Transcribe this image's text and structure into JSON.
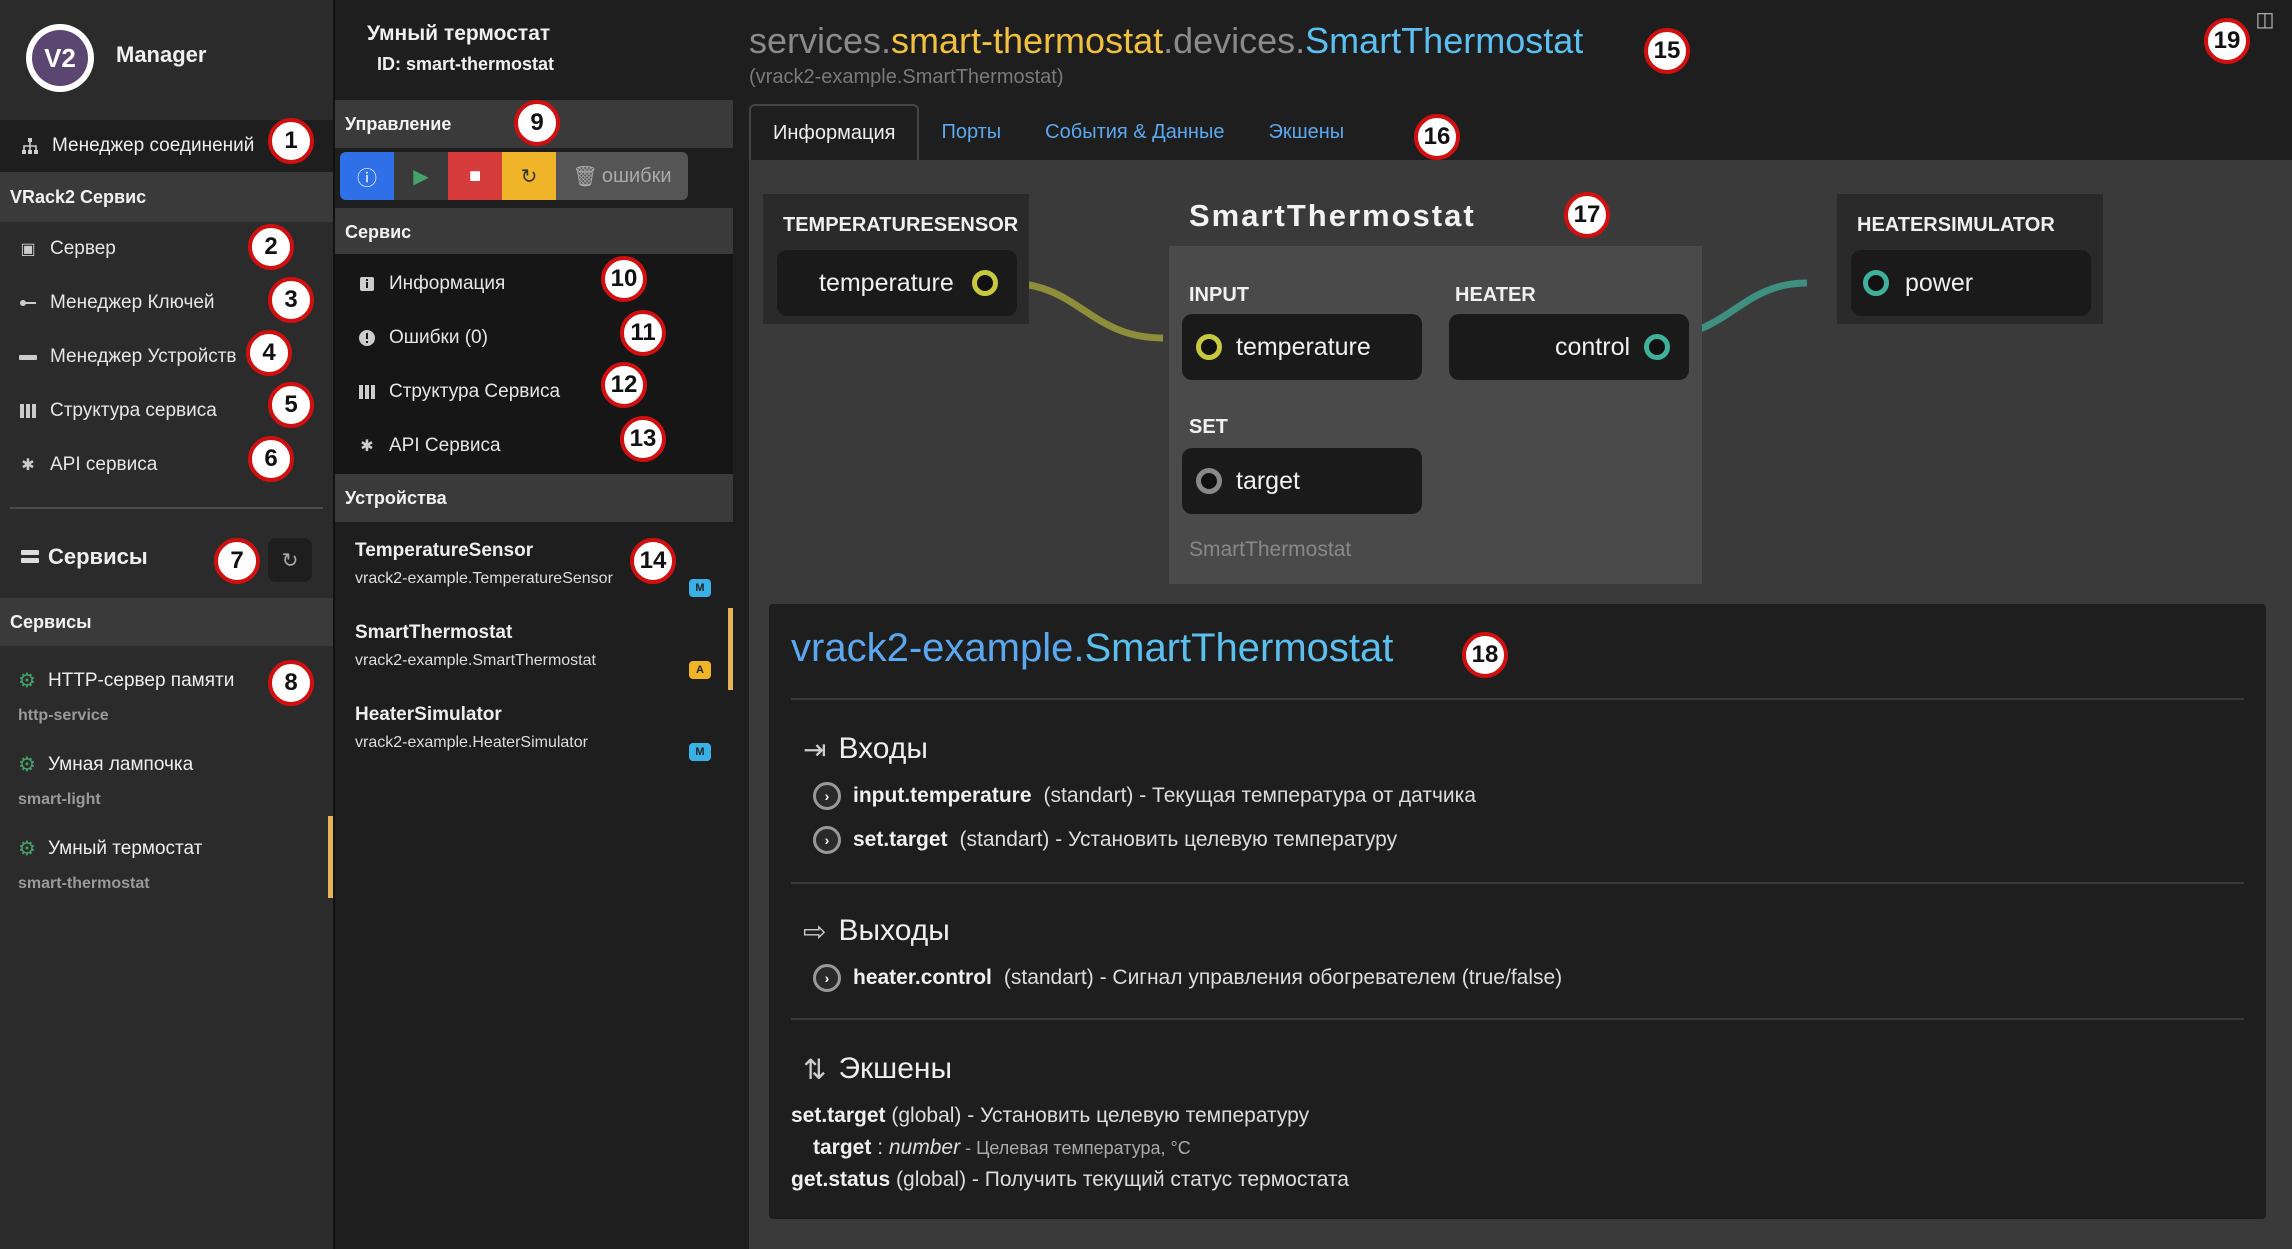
{
  "sidebar": {
    "app_name": "Manager",
    "logo_text": "V2",
    "connection_manager": "Менеджер соединений",
    "vrack_section": "VRack2 Сервис",
    "items": [
      {
        "label": "Сервер",
        "icon": "cube-icon"
      },
      {
        "label": "Менеджер Ключей",
        "icon": "key-icon"
      },
      {
        "label": "Менеджер Устройств",
        "icon": "devices-icon"
      },
      {
        "label": "Структура сервиса",
        "icon": "structure-icon"
      },
      {
        "label": "API сервиса",
        "icon": "asterisk-icon"
      }
    ],
    "services_title": "Сервисы",
    "services_section": "Сервисы",
    "services": [
      {
        "name": "HTTP-сервер памяти",
        "id": "http-service"
      },
      {
        "name": "Умная лампочка",
        "id": "smart-light"
      },
      {
        "name": "Умный термостат",
        "id": "smart-thermostat"
      }
    ]
  },
  "panel": {
    "title": "Умный термостат",
    "id_line": "ID: smart-thermostat",
    "control_section": "Управление",
    "errors_button": "ошибки",
    "service_section": "Сервис",
    "service_items": [
      {
        "label": "Информация",
        "icon": "info-icon"
      },
      {
        "label": "Ошибки (0)",
        "icon": "error-icon"
      },
      {
        "label": "Структура Сервиса",
        "icon": "structure-icon"
      },
      {
        "label": "API Сервиса",
        "icon": "asterisk-icon"
      }
    ],
    "devices_section": "Устройства",
    "devices": [
      {
        "name": "TemperatureSensor",
        "class": "vrack2-example.TemperatureSensor",
        "badge": "M"
      },
      {
        "name": "SmartThermostat",
        "class": "vrack2-example.SmartThermostat",
        "badge": "A"
      },
      {
        "name": "HeaterSimulator",
        "class": "vrack2-example.HeaterSimulator",
        "badge": "M"
      }
    ]
  },
  "main": {
    "title_parts": {
      "p1": "services.",
      "p2": "smart-thermostat",
      "p3": ".devices.",
      "p4": "SmartThermostat"
    },
    "subtitle": "(vrack2-example.SmartThermostat)",
    "tabs": [
      "Информация",
      "Порты",
      "События & Данные",
      "Экшены"
    ],
    "diagram": {
      "left_node": {
        "title": "TEMPERATURESENSOR",
        "port": "temperature"
      },
      "center_node": {
        "title": "SmartThermostat",
        "input_group": "INPUT",
        "input_port": "temperature",
        "heater_group": "HEATER",
        "heater_port": "control",
        "set_group": "SET",
        "set_port": "target",
        "footer": "SmartThermostat"
      },
      "right_node": {
        "title": "HEATERSIMULATOR",
        "port": "power"
      }
    },
    "doc": {
      "title_ns": "vrack2-example.",
      "title_cls": "SmartThermostat",
      "inputs_heading": "Входы",
      "inputs": [
        {
          "name": "input.temperature",
          "rest": "(standart) - Текущая температура от датчика"
        },
        {
          "name": "set.target",
          "rest": "(standart) - Установить целевую температуру"
        }
      ],
      "outputs_heading": "Выходы",
      "outputs": [
        {
          "name": "heater.control",
          "rest": "(standart) - Сигнал управления обогревателем (true/false)"
        }
      ],
      "actions_heading": "Экшены",
      "action1_name": "set.target",
      "action1_rest": "(global) - Установить целевую температуру",
      "param_name": "target",
      "param_sep": " : ",
      "param_type": "number",
      "param_desc": " - Целевая температура, °C",
      "action2_name": "get.status",
      "action2_rest": "(global) - Получить текущий статус термостата"
    }
  },
  "annotations": [
    "1",
    "2",
    "3",
    "4",
    "5",
    "6",
    "7",
    "8",
    "9",
    "10",
    "11",
    "12",
    "13",
    "14",
    "15",
    "16",
    "17",
    "18",
    "19"
  ],
  "colors": {
    "accent_blue": "#5ba8f0",
    "title_yellow": "#f0c040",
    "active_bar": "#e6b35b",
    "green": "#44a26a",
    "link_yellow": "#b5b54a",
    "link_teal": "#3f8f80"
  }
}
